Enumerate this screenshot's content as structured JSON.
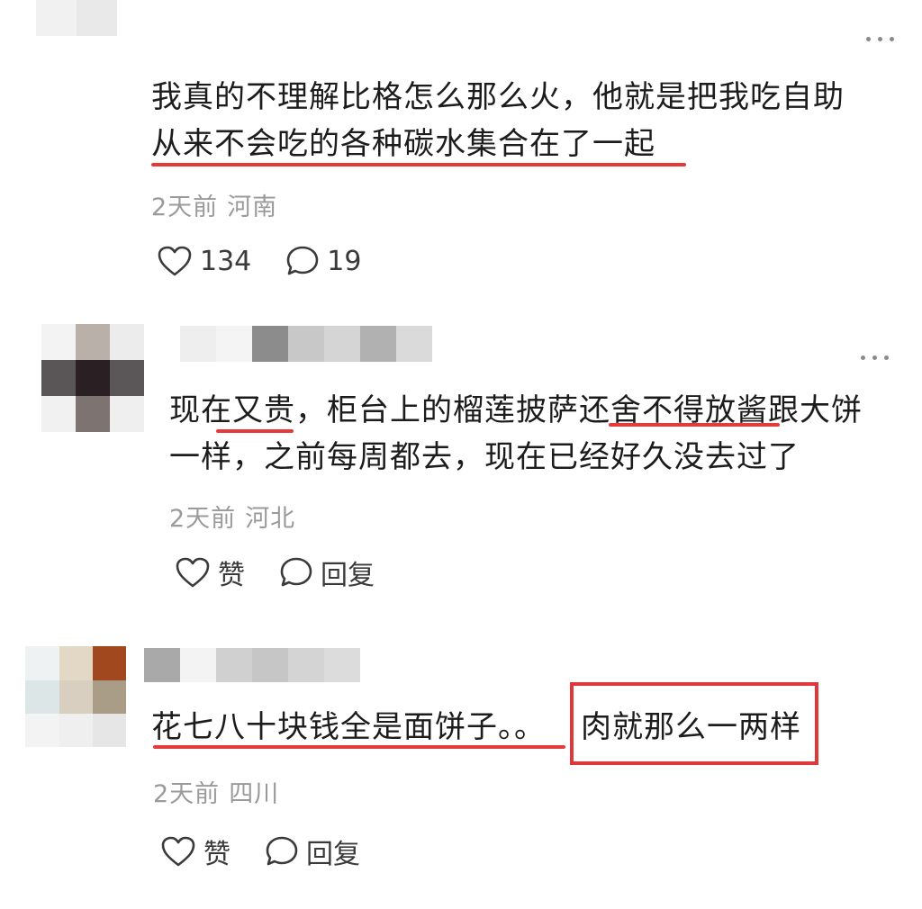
{
  "comments": [
    {
      "lines": [
        "我真的不理解比格怎么那么火，他就是把我吃自助",
        "从来不会吃的各种碳水集合在了一起"
      ],
      "time": "2天前",
      "region": "河南",
      "like_label": "134",
      "reply_label": "19"
    },
    {
      "lines": [
        "现在又贵，柜台上的榴莲披萨还舍不得放酱跟大饼",
        "一样，之前每周都去，现在已经好久没去过了"
      ],
      "time": "2天前",
      "region": "河北",
      "like_label": "赞",
      "reply_label": "回复"
    },
    {
      "line_a": "花七八十块钱全是面饼子。。",
      "line_b": "肉就那么一两样",
      "time": "2天前",
      "region": "四川",
      "like_label": "赞",
      "reply_label": "回复"
    }
  ],
  "icons": {
    "more": "more-dots-icon",
    "like": "heart-outline-icon",
    "reply": "speech-bubble-icon"
  },
  "colors": {
    "highlight": "#e53a3a",
    "meta_text": "#9a9a9a",
    "body_text": "#1c1c1c"
  }
}
